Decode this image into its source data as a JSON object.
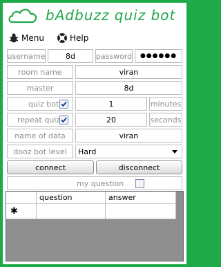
{
  "app": {
    "title": "bAdbuzz quiz bot"
  },
  "menu": [
    {
      "label": "Menu",
      "icon": "bug-icon"
    },
    {
      "label": "Help",
      "icon": "help-icon"
    }
  ],
  "login": {
    "username_label": "username",
    "username_value": "8d",
    "password_label": "password",
    "password_value": "●●●●●●"
  },
  "fields": {
    "room_name_label": "room name",
    "room_name_value": "viran",
    "master_label": "master",
    "master_value": "8d",
    "quiz_bot_label": "quiz bot",
    "quiz_bot_checked": true,
    "quiz_bot_value": "1",
    "quiz_bot_unit": "minutes",
    "repeat_quiz_label": "repeat quiz",
    "repeat_quiz_checked": true,
    "repeat_quiz_value": "20",
    "repeat_quiz_unit": "seconds",
    "name_of_data_label": "name of data",
    "name_of_data_value": "viran",
    "dooz_bot_label": "dooz bot level",
    "dooz_bot_value": "Hard"
  },
  "buttons": {
    "connect": "connect",
    "disconnect": "disconnect"
  },
  "my_question": {
    "label": "my question",
    "checked": false
  },
  "table": {
    "columns": [
      "question",
      "answer"
    ],
    "new_row_marker": "✱"
  }
}
